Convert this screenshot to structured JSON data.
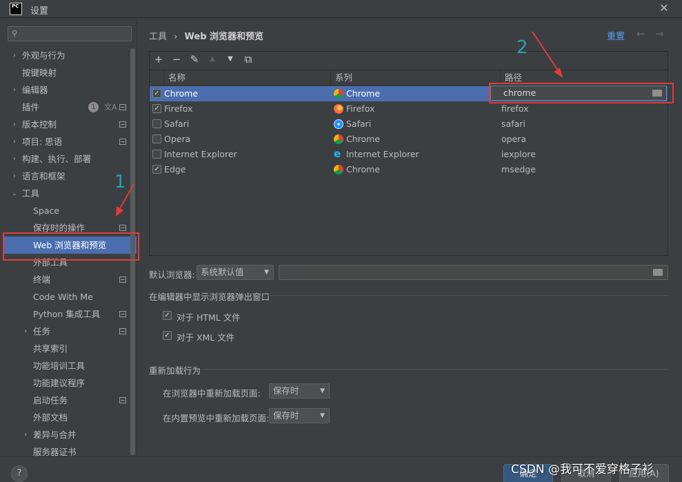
{
  "window": {
    "app_logo_text": "PC",
    "title": "设置"
  },
  "sidebar": {
    "search_placeholder": "",
    "items": [
      {
        "label": "外观与行为",
        "chevron": "›",
        "badge": "",
        "has_side_icon": false
      },
      {
        "label": "按键映射",
        "chevron": "",
        "badge": "",
        "has_side_icon": false
      },
      {
        "label": "编辑器",
        "chevron": "›",
        "badge": "",
        "has_side_icon": false
      },
      {
        "label": "插件",
        "chevron": "",
        "badge": "1",
        "has_side_icon": true
      },
      {
        "label": "版本控制",
        "chevron": "›",
        "badge": "",
        "has_side_icon": true
      },
      {
        "label": "项目: 思语",
        "chevron": "›",
        "badge": "",
        "has_side_icon": true
      },
      {
        "label": "构建、执行、部署",
        "chevron": "›",
        "badge": "",
        "has_side_icon": false
      },
      {
        "label": "语言和框架",
        "chevron": "›",
        "badge": "",
        "has_side_icon": false
      },
      {
        "label": "工具",
        "chevron": "⌄",
        "badge": "",
        "has_side_icon": false
      },
      {
        "label": "Space",
        "chevron": "",
        "badge": "",
        "has_side_icon": false
      },
      {
        "label": "保存时的操作",
        "chevron": "",
        "badge": "",
        "has_side_icon": true
      },
      {
        "label": "Web 浏览器和预览",
        "chevron": "",
        "badge": "",
        "has_side_icon": false,
        "selected": true
      },
      {
        "label": "外部工具",
        "chevron": "",
        "badge": "",
        "has_side_icon": false
      },
      {
        "label": "终端",
        "chevron": "",
        "badge": "",
        "has_side_icon": true
      },
      {
        "label": "Code With Me",
        "chevron": "",
        "badge": "",
        "has_side_icon": false
      },
      {
        "label": "Python 集成工具",
        "chevron": "",
        "badge": "",
        "has_side_icon": true
      },
      {
        "label": "任务",
        "chevron": "›",
        "badge": "",
        "has_side_icon": true
      },
      {
        "label": "共享索引",
        "chevron": "",
        "badge": "",
        "has_side_icon": false
      },
      {
        "label": "功能培训工具",
        "chevron": "",
        "badge": "",
        "has_side_icon": false
      },
      {
        "label": "功能建议程序",
        "chevron": "",
        "badge": "",
        "has_side_icon": false
      },
      {
        "label": "启动任务",
        "chevron": "",
        "badge": "",
        "has_side_icon": true
      },
      {
        "label": "外部文档",
        "chevron": "",
        "badge": "",
        "has_side_icon": false
      },
      {
        "label": "差异与合并",
        "chevron": "›",
        "badge": "",
        "has_side_icon": false
      },
      {
        "label": "服务器证书",
        "chevron": "",
        "badge": "",
        "has_side_icon": false
      }
    ]
  },
  "header": {
    "breadcrumb_parent": "工具",
    "breadcrumb_separator": "›",
    "breadcrumb_current": "Web 浏览器和预览",
    "reset_label": "重置",
    "back_arrow": "←",
    "forward_arrow": "→"
  },
  "toolbar": {
    "add": "+",
    "remove": "−",
    "edit": "✎",
    "up": "▲",
    "down": "▼",
    "copy": "⧉"
  },
  "table": {
    "columns": [
      "名称",
      "系列",
      "路径"
    ],
    "rows": [
      {
        "checked": true,
        "name": "Chrome",
        "family": "Chrome",
        "family_icon": "chrome-icon",
        "path": "chrome",
        "selected": true
      },
      {
        "checked": true,
        "name": "Firefox",
        "family": "Firefox",
        "family_icon": "firefox-icon",
        "path": "firefox"
      },
      {
        "checked": false,
        "name": "Safari",
        "family": "Safari",
        "family_icon": "safari-icon",
        "path": "safari"
      },
      {
        "checked": false,
        "name": "Opera",
        "family": "Chrome",
        "family_icon": "chrome-icon",
        "path": "opera"
      },
      {
        "checked": false,
        "name": "Internet Explorer",
        "family": "Internet Explorer",
        "family_icon": "ie-icon",
        "path": "iexplore"
      },
      {
        "checked": true,
        "name": "Edge",
        "family": "Chrome",
        "family_icon": "chrome-icon",
        "path": "msedge"
      }
    ],
    "editing_path_value": "chrome"
  },
  "default_browser": {
    "label": "默认浏览器:",
    "value": "系统默认值",
    "path_value": ""
  },
  "popup_section": {
    "title": "在编辑器中显示浏览器弹出窗口",
    "html_label": "对于 HTML 文件",
    "html_checked": true,
    "xml_label": "对于 XML 文件",
    "xml_checked": true
  },
  "reload_section": {
    "title": "重新加载行为",
    "browser_label": "在浏览器中重新加载页面:",
    "browser_value": "保存时",
    "preview_label": "在内置预览中重新加载页面:",
    "preview_value": "保存时"
  },
  "footer": {
    "help": "?",
    "ok": "确定",
    "cancel": "取消",
    "apply": "应用(A)"
  },
  "annotations": {
    "step1": "1",
    "step2": "2",
    "color": "#e23b3b",
    "number_color": "#2a9fb2"
  },
  "watermark": "CSDN @我可不爱穿格子衫",
  "colors": {
    "background": "#3c3f41",
    "selection": "#4b6eaf",
    "link": "#589df6",
    "primary_button": "#365880"
  }
}
